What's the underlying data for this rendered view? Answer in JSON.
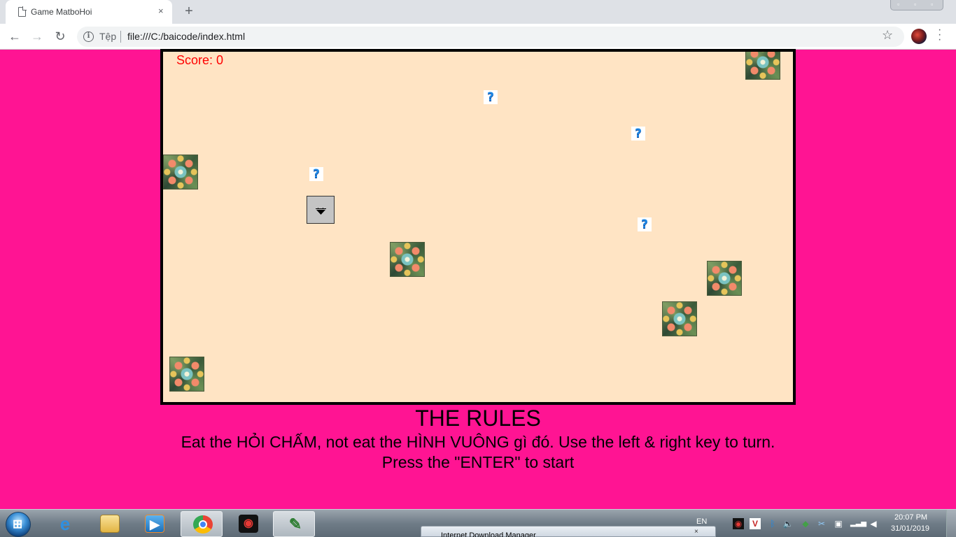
{
  "browser": {
    "tab_title": "Game MatboHoi",
    "tab_close": "×",
    "new_tab": "+",
    "origin_chip": "Tệp",
    "url": "file:///C:/baicode/index.html",
    "icons": [
      "page-icon",
      "close-icon",
      "new-tab-icon",
      "back-icon",
      "forward-icon",
      "reload-icon",
      "info-icon",
      "star-icon",
      "profile-avatar",
      "menu-icon"
    ]
  },
  "game": {
    "score_label": "Score: 0",
    "score_value": 0,
    "question_marks": 4,
    "square_tiles": 7,
    "background_color": "#ffe4c4"
  },
  "rules": {
    "title": "THE RULES",
    "line1": "Eat the HỎI CHẤM, not eat the HÌNH VUÔNG gì đó. Use the left & right key to turn.",
    "line2": "Press the \"ENTER\" to start"
  },
  "taskbar": {
    "language": "EN",
    "time": "20:07 PM",
    "date": "31/01/2019",
    "popup_title": "Internet Download Manager",
    "apps": [
      "internet-explorer",
      "file-explorer",
      "media-player",
      "chrome",
      "garena",
      "tool"
    ]
  },
  "colors": {
    "page_background": "#ff1493",
    "score_color": "#ff0000",
    "question_mark_color": "#1e88e5"
  }
}
